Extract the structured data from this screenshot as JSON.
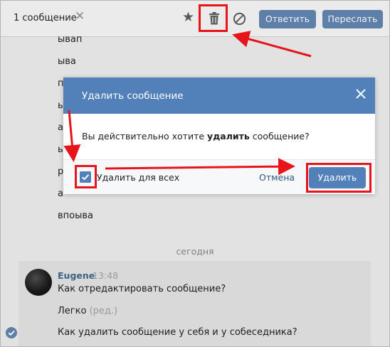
{
  "header": {
    "selected_count": "1 сообщение",
    "reply_label": "Ответить",
    "forward_label": "Переслать",
    "icons": [
      "close-icon",
      "star-icon",
      "trash-icon",
      "block-icon"
    ]
  },
  "history": {
    "lines": [
      "ывап",
      "ыва",
      "п",
      "ы",
      "а",
      "ы",
      "р",
      "а",
      "впоыва"
    ],
    "date_separator": "сегодня",
    "message": {
      "author": "Eugene",
      "time": "13:48",
      "text1": "Как отредактировать сообщение?",
      "text2": "Легко",
      "edited_mark": "(ред.)",
      "text3": "Как удалить сообщение у себя и у собеседника?"
    }
  },
  "modal": {
    "title": "Удалить сообщение",
    "question_prefix": "Вы действительно хотите ",
    "question_bold": "удалить",
    "question_suffix": " сообщение?",
    "checkbox_label": "Удалить для всех",
    "checkbox_checked": true,
    "cancel_label": "Отмена",
    "delete_label": "Удалить"
  },
  "colors": {
    "modal_header": "#5181b8",
    "header_button": "#5d7fa8",
    "author_link": "#3e6186",
    "annotation": "#e8141c"
  }
}
